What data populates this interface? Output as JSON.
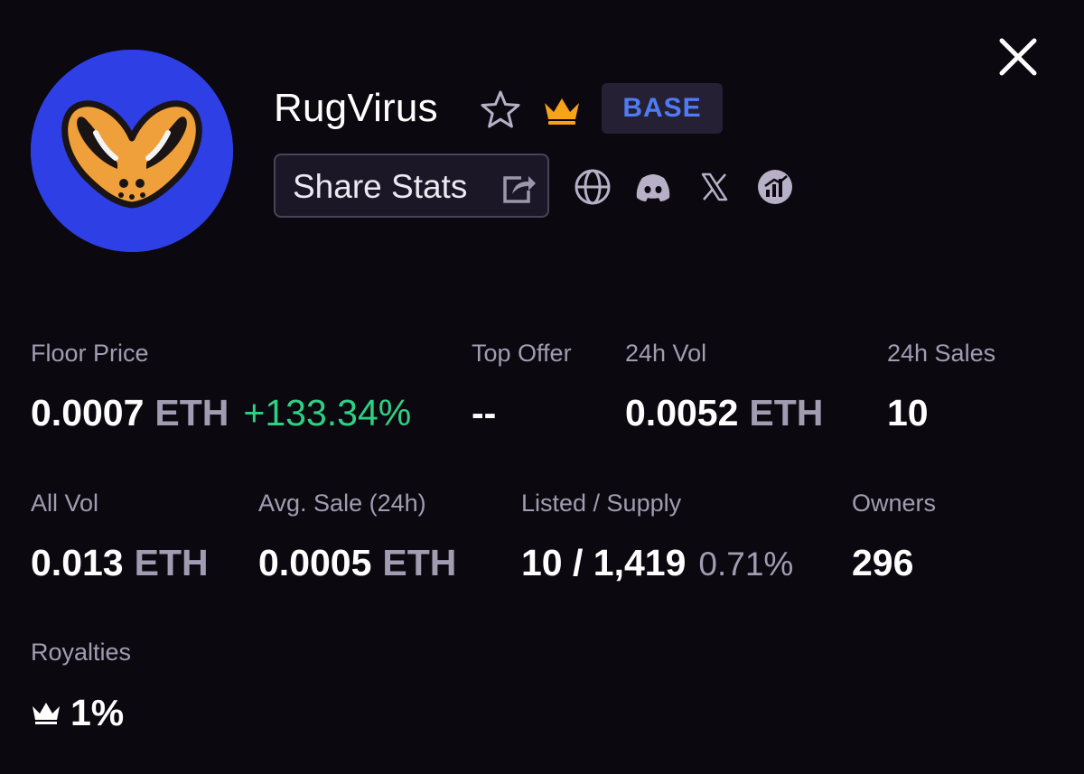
{
  "collection": {
    "name": "RugVirus",
    "chain_badge": "BASE",
    "share_label": "Share Stats",
    "avatar_bg": "#2e3fe6"
  },
  "icons": {
    "close": "close-icon",
    "favorite": "star-icon",
    "verified": "crown-icon",
    "share": "share-icon",
    "socials": [
      "globe-icon",
      "discord-icon",
      "x-icon",
      "chart-icon"
    ]
  },
  "colors": {
    "background": "#0b080f",
    "positive": "#2ed184",
    "chain_badge": "#4f7cf5",
    "crown": "#f7a218"
  },
  "stats": {
    "floor_price": {
      "label": "Floor Price",
      "value": "0.0007",
      "unit": "ETH",
      "change": "+133.34%"
    },
    "top_offer": {
      "label": "Top Offer",
      "value": "--"
    },
    "vol_24h": {
      "label": "24h Vol",
      "value": "0.0052",
      "unit": "ETH"
    },
    "sales_24h": {
      "label": "24h Sales",
      "value": "10"
    },
    "all_vol": {
      "label": "All Vol",
      "value": "0.013",
      "unit": "ETH"
    },
    "avg_sale": {
      "label": "Avg. Sale (24h)",
      "value": "0.0005",
      "unit": "ETH"
    },
    "listed_supply": {
      "label": "Listed / Supply",
      "value": "10 / 1,419",
      "pct": "0.71%"
    },
    "owners": {
      "label": "Owners",
      "value": "296"
    },
    "royalties": {
      "label": "Royalties",
      "value": "1%"
    }
  }
}
